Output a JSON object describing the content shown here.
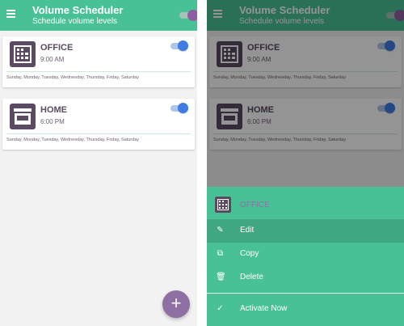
{
  "app": {
    "title": "Volume Scheduler",
    "subtitle": "Schedule volume levels",
    "master_enabled": true
  },
  "schedules": [
    {
      "name": "OFFICE",
      "time": "9:00 AM",
      "days": "Sunday, Monday, Tuesday, Wednesday, Thursday, Friday, Saturday",
      "enabled": true,
      "icon": "office-building-icon"
    },
    {
      "name": "HOME",
      "time": "6:00 PM",
      "days": "Sunday, Monday, Tuesday, Wednesday, Thursday, Friday, Saturday",
      "enabled": true,
      "icon": "home-store-icon"
    }
  ],
  "fab": {
    "label": "+"
  },
  "context_menu": {
    "title": "OFFICE",
    "items": [
      {
        "label": "Edit",
        "icon": "pencil-icon"
      },
      {
        "label": "Copy",
        "icon": "copy-icon"
      },
      {
        "label": "Delete",
        "icon": "trash-icon"
      },
      {
        "label": "Activate Now",
        "icon": "check-icon"
      }
    ]
  },
  "colors": {
    "primary": "#49c196",
    "primary_dark": "#3fa881",
    "accent": "#8e6fa2",
    "toggle_on": "#3f7de4",
    "icon_dark": "#5b4b62"
  }
}
